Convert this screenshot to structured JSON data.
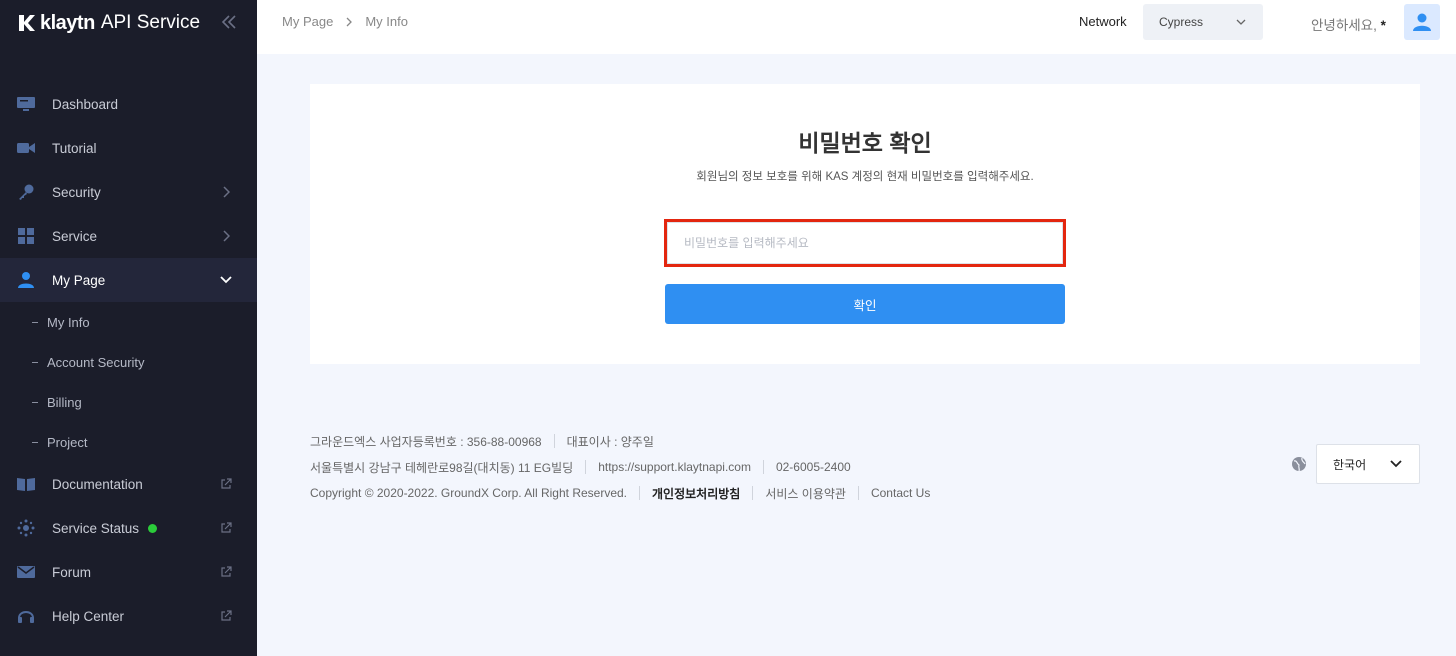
{
  "logo": {
    "brand": "klaytn",
    "service": "API Service"
  },
  "sidebar": {
    "items": [
      {
        "label": "Dashboard",
        "icon": "dashboard-icon"
      },
      {
        "label": "Tutorial",
        "icon": "video-icon"
      },
      {
        "label": "Security",
        "icon": "key-icon"
      },
      {
        "label": "Service",
        "icon": "grid-icon"
      },
      {
        "label": "My Page",
        "icon": "user-icon"
      },
      {
        "label": "Documentation",
        "icon": "book-icon"
      },
      {
        "label": "Service Status",
        "icon": "status-icon"
      },
      {
        "label": "Forum",
        "icon": "mail-icon"
      },
      {
        "label": "Help Center",
        "icon": "headset-icon"
      }
    ],
    "sub_items": [
      {
        "label": "My Info"
      },
      {
        "label": "Account Security"
      },
      {
        "label": "Billing"
      },
      {
        "label": "Project"
      }
    ]
  },
  "header": {
    "breadcrumb": [
      "My Page",
      "My Info"
    ],
    "network_label": "Network",
    "network_value": "Cypress",
    "greeting": "안녕하세요,",
    "user": "*"
  },
  "card": {
    "title": "비밀번호 확인",
    "description": "회원님의 정보 보호를 위해 KAS 계정의 현재 비밀번호를 입력해주세요.",
    "password_placeholder": "비밀번호를 입력해주세요",
    "confirm_label": "확인"
  },
  "footer": {
    "company": "그라운드엑스 사업자등록번호 : 356-88-00968",
    "ceo": "대표이사 : 양주일",
    "address": "서울특별시 강남구 테헤란로98길(대치동) 11 EG빌딩",
    "support_url": "https://support.klaytnapi.com",
    "phone": "02-6005-2400",
    "copyright": "Copyright © 2020-2022. GroundX Corp. All Right Reserved.",
    "privacy": "개인정보처리방침",
    "terms": "서비스 이용약관",
    "contact": "Contact Us",
    "language": "한국어"
  },
  "colors": {
    "sidebar_bg": "#1b1d2a",
    "accent": "#2f8ff2",
    "highlight_border": "#e3260f",
    "status_green": "#2bcc3a"
  }
}
